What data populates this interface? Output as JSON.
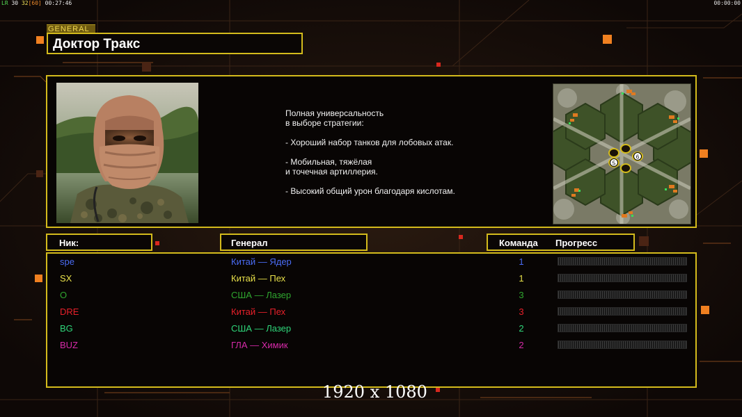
{
  "topbar": {
    "fps_label": "LR",
    "fps_a": "30",
    "fps_b": "32",
    "fps_c": "[60]",
    "elapsed": "00:27:46",
    "clock": "00:00:00"
  },
  "general": {
    "tag": "GENERAL",
    "name": "Доктор Тракс",
    "description": [
      "Полная универсальность\nв выборе стратегии:",
      "- Хороший набор танков для лобовых атак.",
      "- Мобильная, тяжёлая\nи точечная артиллерия.",
      "- Высокий общий урон благодаря кислотам."
    ],
    "portrait_icon": "masked-soldier-portrait",
    "minimap_icon": "hexagon-map-preview",
    "map_slots": [
      "6",
      "5"
    ]
  },
  "table": {
    "headers": {
      "nick": "Ник:",
      "general": "Генерал",
      "team": "Команда",
      "progress": "Прогресс"
    },
    "players": [
      {
        "nick": "spe",
        "general": "Китай — Ядер",
        "team": "1",
        "color": "#4a6cf5",
        "progress": 0
      },
      {
        "nick": "SX",
        "general": "Китай — Пех",
        "team": "1",
        "color": "#e8e04a",
        "progress": 0
      },
      {
        "nick": "O",
        "general": "США — Лазер",
        "team": "3",
        "color": "#2fa62f",
        "progress": 0
      },
      {
        "nick": "DRE",
        "general": "Китай — Пех",
        "team": "3",
        "color": "#e8202a",
        "progress": 0
      },
      {
        "nick": "BG",
        "general": "США — Лазер",
        "team": "2",
        "color": "#2fd67a",
        "progress": 0
      },
      {
        "nick": "BUZ",
        "general": "ГЛА — Химик",
        "team": "2",
        "color": "#d62aa8",
        "progress": 0
      }
    ]
  },
  "watermark": "1920 x 1080",
  "colors": {
    "panel_border": "#d4bb1c",
    "background": "#120b08",
    "accent_orange": "#f08020"
  }
}
